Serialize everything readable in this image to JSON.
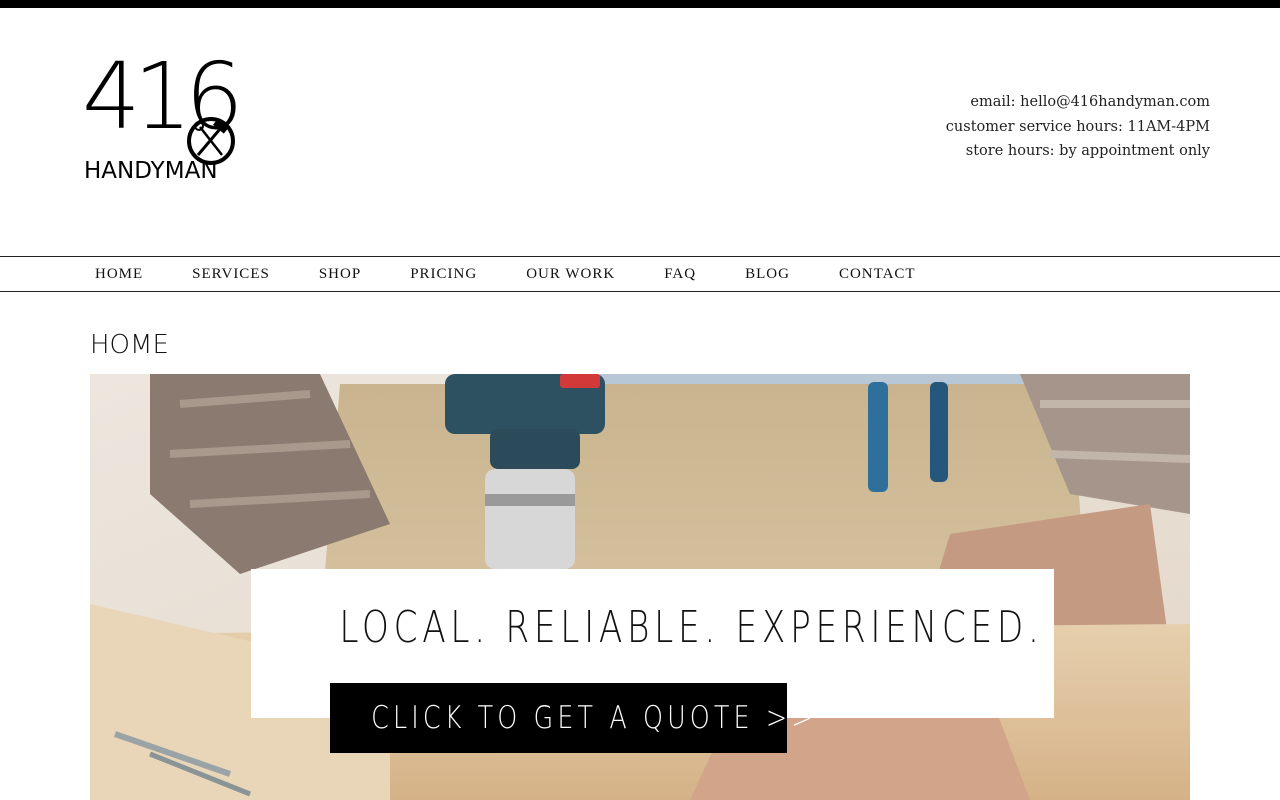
{
  "brand": {
    "logo_number": "416",
    "logo_word": "HANDYMAN",
    "logo_icon": "hammer-wrench-icon"
  },
  "contact": {
    "email": "email: hello@416handyman.com",
    "service_hours": "customer service hours: 11AM-4PM",
    "store_hours": "store hours: by appointment only"
  },
  "nav": {
    "items": [
      {
        "label": "HOME"
      },
      {
        "label": "SERVICES"
      },
      {
        "label": "SHOP"
      },
      {
        "label": "PRICING"
      },
      {
        "label": "OUR WORK"
      },
      {
        "label": "FAQ"
      },
      {
        "label": "BLOG"
      },
      {
        "label": "CONTACT"
      }
    ]
  },
  "page": {
    "title": "HOME"
  },
  "hero": {
    "tagline": "LOCAL. RELIABLE. EXPERIENCED.",
    "cta_label": "CLICK TO GET A QUOTE >>"
  },
  "colors": {
    "text": "#111111",
    "top_bar": "#000000",
    "cta_background": "#000000",
    "cta_text": "#ffffff"
  }
}
